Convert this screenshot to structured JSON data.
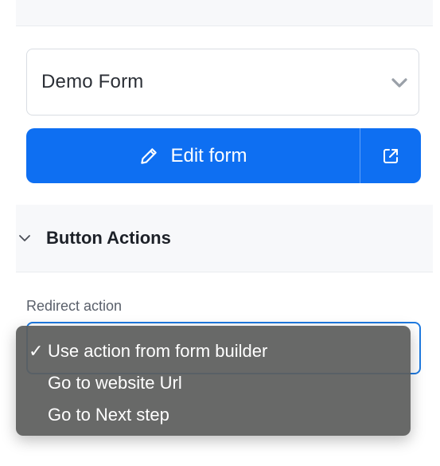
{
  "form_picker": {
    "selected_value": "Demo Form",
    "icon": "chevron-down-icon"
  },
  "edit_button": {
    "label": "Edit form",
    "icon": "pencil-icon",
    "external_icon": "external-link-icon",
    "color": "#0e6ff2"
  },
  "button_actions": {
    "title": "Button Actions",
    "icon": "chevron-down-icon"
  },
  "redirect": {
    "label": "Redirect action",
    "options": [
      {
        "label": "Use action from form builder",
        "selected": true,
        "check": "✓"
      },
      {
        "label": "Go to website Url",
        "selected": false,
        "check": ""
      },
      {
        "label": "Go to Next step",
        "selected": false,
        "check": ""
      }
    ]
  }
}
